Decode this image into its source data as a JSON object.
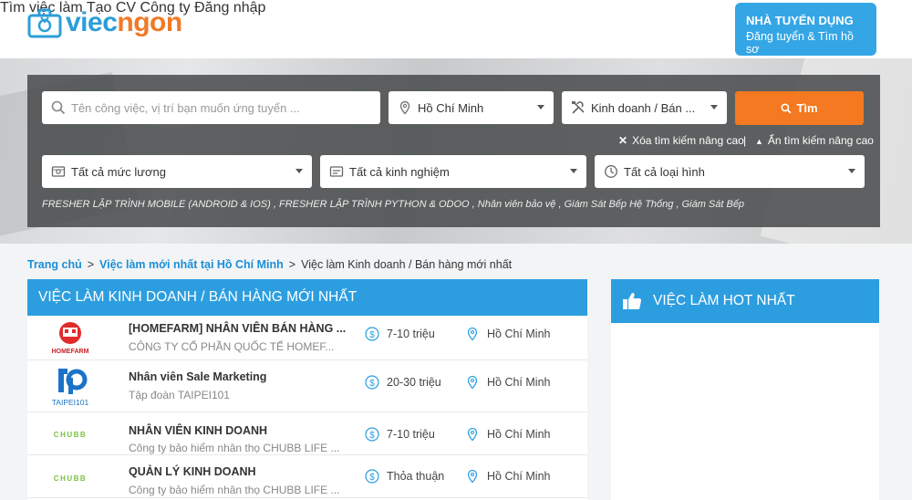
{
  "header": {
    "logo": {
      "part1": "viec",
      "part2": "ngon"
    },
    "nav": [
      "Tìm việc làm",
      "Tạo CV",
      "Công ty",
      "Đăng nhập"
    ],
    "recruiter": {
      "title": "NHÀ TUYỂN DỤNG",
      "subtitle": "Đăng tuyển & Tìm hồ sơ"
    }
  },
  "search": {
    "keyword_placeholder": "Tên công việc, vị trí bạn muốn ứng tuyển ...",
    "location": "Hồ Chí Minh",
    "category": "Kinh doanh / Bán ...",
    "button": "Tìm",
    "clear_advanced": "Xóa tìm kiếm nâng cao",
    "divider": "|",
    "hide_advanced": "Ẩn tìm kiếm nâng cao",
    "salary": "Tất cả mức lương",
    "experience": "Tất cả kinh nghiệm",
    "job_type": "Tất cả loại hình",
    "hot_keywords": [
      "FRESHER LẬP TRÌNH MOBILE (ANDROID & IOS)",
      "FRESHER LẬP TRÌNH PYTHON & ODOO",
      "Nhân viên bảo vệ",
      "Giám Sát Bếp Hệ Thống",
      "Giám Sát Bếp"
    ],
    "keyword_separator": " , "
  },
  "breadcrumb": {
    "home": "Trang chủ",
    "level2": "Việc làm mới nhất tại Hồ Chí Minh",
    "current": "Việc làm Kinh doanh / Bán hàng mới nhất",
    "sep": ">"
  },
  "job_list": {
    "title": "VIỆC LÀM KINH DOANH / BÁN HÀNG MỚI NHẤT",
    "jobs": [
      {
        "title": "[HOMEFARM] NHÂN VIÊN BÁN HÀNG ...",
        "company": "CÔNG TY CỔ PHẦN QUỐC TẾ HOMEF...",
        "salary": "7-10 triệu",
        "location": "Hồ Chí Minh",
        "logo_text": "HOMEFARM"
      },
      {
        "title": "Nhân viên Sale Marketing",
        "company": "Tập đoàn TAIPEI101",
        "salary": "20-30 triệu",
        "location": "Hồ Chí Minh",
        "logo_text": "TAIPEI101"
      },
      {
        "title": "NHÂN VIÊN KINH DOANH",
        "company": "Công ty bảo hiểm nhân thọ CHUBB LIFE ...",
        "salary": "7-10 triệu",
        "location": "Hồ Chí Minh",
        "logo_text": "CHUBB"
      },
      {
        "title": "QUẢN LÝ KINH DOANH",
        "company": "Công ty bảo hiểm nhân thọ CHUBB LIFE ...",
        "salary": "Thỏa thuận",
        "location": "Hồ Chí Minh",
        "logo_text": "CHUBB"
      }
    ]
  },
  "hot_jobs": {
    "title": "VIỆC LÀM HOT NHẤT"
  },
  "colors": {
    "primary": "#2c9ee0",
    "accent": "#f47920",
    "logo_blue": "#2b9ed9",
    "logo_orange": "#f07a28"
  }
}
